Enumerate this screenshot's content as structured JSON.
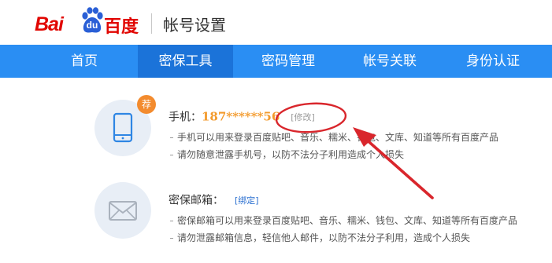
{
  "header": {
    "logo_bai": "Bai",
    "logo_du": "du",
    "logo_cn": "百度",
    "title": "帐号设置"
  },
  "nav": {
    "items": [
      {
        "label": "首页"
      },
      {
        "label": "密保工具"
      },
      {
        "label": "密码管理"
      },
      {
        "label": "帐号关联"
      },
      {
        "label": "身份认证"
      }
    ]
  },
  "phone_section": {
    "badge": "荐",
    "label": "手机：",
    "value": "187******56",
    "action": "[修改]",
    "desc": [
      "手机可以用来登录百度贴吧、音乐、糯米、钱包、文库、知道等所有百度产品",
      "请勿随意泄露手机号，以防不法分子利用造成个人损失"
    ]
  },
  "email_section": {
    "label": "密保邮箱：",
    "action": "[绑定]",
    "desc": [
      "密保邮箱可以用来登录百度贴吧、音乐、糯米、钱包、文库、知道等所有百度产品",
      "请勿泄露邮箱信息，轻信他人邮件，以防不法分子利用，造成个人损失"
    ]
  },
  "colors": {
    "brand_red": "#e10601",
    "nav_blue": "#2a8ef3",
    "nav_active": "#1b73d9",
    "phone_orange": "#f39a2b",
    "badge_orange": "#f38b2e",
    "annotation_red": "#d9262c"
  },
  "icons": [
    "baidu-paw-icon",
    "mobile-phone-icon",
    "envelope-icon"
  ]
}
